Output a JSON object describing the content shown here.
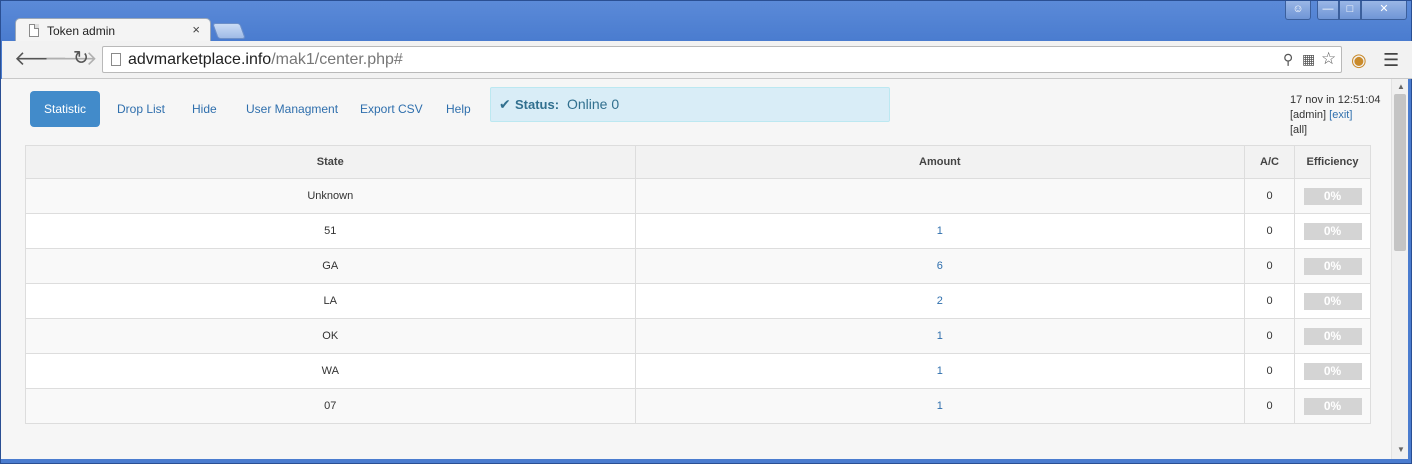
{
  "browser": {
    "tab_title": "Token admin",
    "tab_close": "×",
    "url_host": "advmarketplace.info",
    "url_path": "/mak1/center.php#"
  },
  "nav": {
    "items": [
      "Statistic",
      "Drop List",
      "Hide",
      "User Managment",
      "Export CSV",
      "Help"
    ],
    "active": "Statistic"
  },
  "status": {
    "label": "Status:",
    "value": "Online 0"
  },
  "session": {
    "datetime": "17 nov in 12:51:04",
    "user": "[admin]",
    "exit": "[exit]",
    "all": "[all]"
  },
  "table": {
    "headers": [
      "State",
      "Amount",
      "A/C",
      "Efficiency"
    ],
    "rows": [
      {
        "state": "Unknown",
        "amount": "",
        "ac": "0",
        "efficiency": "0%"
      },
      {
        "state": "51",
        "amount": "1",
        "ac": "0",
        "efficiency": "0%"
      },
      {
        "state": "GA",
        "amount": "6",
        "ac": "0",
        "efficiency": "0%"
      },
      {
        "state": "LA",
        "amount": "2",
        "ac": "0",
        "efficiency": "0%"
      },
      {
        "state": "OK",
        "amount": "1",
        "ac": "0",
        "efficiency": "0%"
      },
      {
        "state": "WA",
        "amount": "1",
        "ac": "0",
        "efficiency": "0%"
      },
      {
        "state": "07",
        "amount": "1",
        "ac": "0",
        "efficiency": "0%"
      }
    ]
  },
  "colors": {
    "accent": "#428bca",
    "link": "#2f6fad",
    "alert_bg": "#d9edf7",
    "alert_text": "#31708f",
    "efficiency_bar": "#d4d4d4"
  },
  "icons": {
    "back": "back-arrow-icon",
    "forward": "forward-arrow-icon",
    "reload": "reload-icon",
    "key": "key-icon",
    "translate": "translate-icon",
    "bookmark": "star-icon",
    "extension": "cookie-icon",
    "menu": "hamburger-menu-icon",
    "status": "checkmark-icon"
  }
}
